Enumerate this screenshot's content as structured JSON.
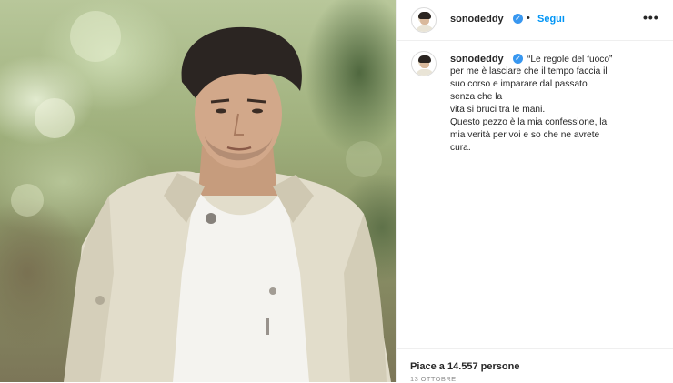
{
  "post": {
    "username": "sonodeddy",
    "follow_label": "Segui",
    "dot": "•",
    "verified_glyph": "✓",
    "more_glyph": "•••",
    "caption_lines": [
      "“Le regole del fuoco”",
      "per me è lasciare che il tempo faccia il",
      "suo corso e imparare dal passato",
      "senza che la",
      "vita si bruci tra le mani.",
      "Questo pezzo è la mia confessione, la",
      "mia verità per voi e so che ne avrete",
      "cura."
    ],
    "likes": "Piace a 14.557 persone",
    "date": "13 OTTOBRE"
  },
  "colors": {
    "accent": "#0095f6",
    "verified": "#3897f0",
    "text": "#262626",
    "muted": "#8e8e8e"
  },
  "icons": {
    "verified": "verified-badge-icon",
    "more": "more-options-icon"
  }
}
